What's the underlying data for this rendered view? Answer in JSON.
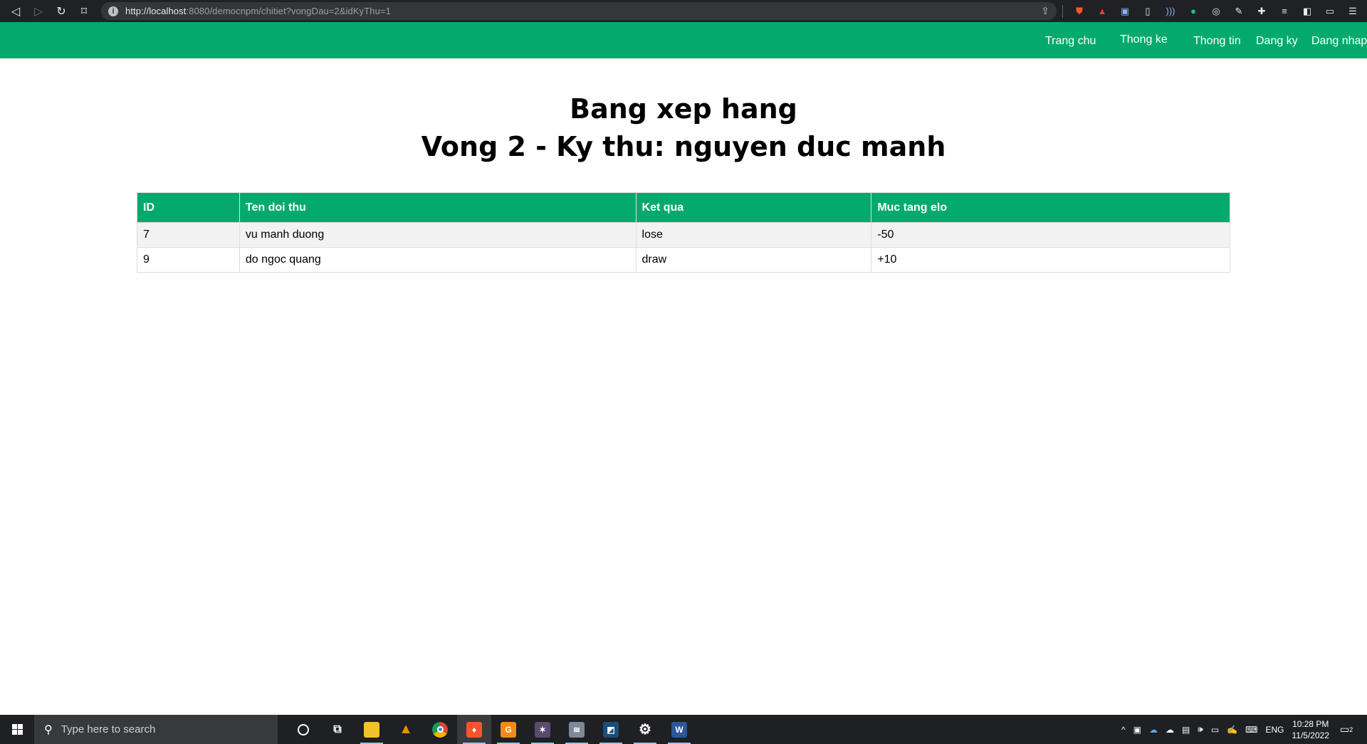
{
  "browser": {
    "url_host": "http://localhost",
    "url_rest": ":8080/democnpm/chitiet?vongDau=2&idKyThu=1"
  },
  "navbar": {
    "items": [
      {
        "label": "Trang chu"
      },
      {
        "label": "Thong ke"
      },
      {
        "label": "Thong tin"
      },
      {
        "label": "Dang ky"
      },
      {
        "label": "Dang nhap"
      }
    ],
    "color": "#04aa6d"
  },
  "page": {
    "title": "Bang xep hang",
    "subtitle": "Vong 2 - Ky thu: nguyen duc manh"
  },
  "table": {
    "headers": [
      "ID",
      "Ten doi thu",
      "Ket qua",
      "Muc tang elo"
    ],
    "rows": [
      [
        "7",
        "vu manh duong",
        "lose",
        "-50"
      ],
      [
        "9",
        "do ngoc quang",
        "draw",
        "+10"
      ]
    ]
  },
  "taskbar": {
    "search_placeholder": "Type here to search",
    "language": "ENG",
    "time": "10:28 PM",
    "date": "11/5/2022",
    "notification_count": "2"
  }
}
